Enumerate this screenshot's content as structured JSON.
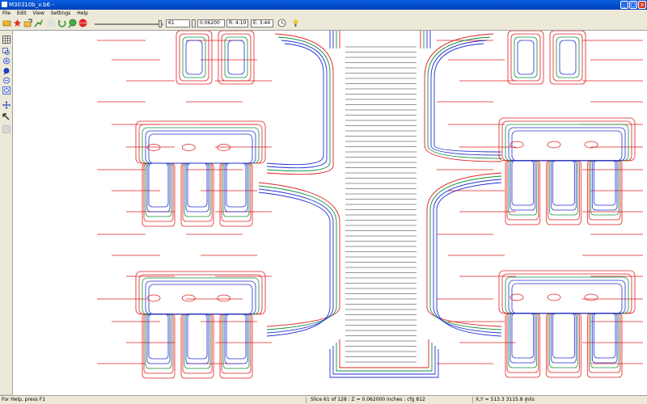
{
  "window": {
    "title": "M30310b_v.b6 -"
  },
  "menu": [
    "File",
    "Edit",
    "View",
    "Settings",
    "Help"
  ],
  "toolbar": {
    "layer_value": "61",
    "thickness_value": "0.06200",
    "readout_r": "R: 4:10",
    "readout_e": "E: 3:44"
  },
  "status": {
    "help": "For Help, press F1",
    "slice": "Slice   61 of   128 : Z = 0.062000 inches : cfg 812",
    "coords": "X,Y =   513.3   3115.8 mils"
  },
  "colors": {
    "red": "#e02020",
    "blue": "#2030d0",
    "green": "#109040",
    "grey": "#707070"
  },
  "icons": {
    "toolbar": [
      "open-folder-icon",
      "wizard-icon",
      "open-icon",
      "plot-icon",
      "blank-icon",
      "rotate-icon",
      "zoom-icon",
      "stop-icon"
    ],
    "left": [
      "grid-icon",
      "zoom-box-icon",
      "zoom-in-icon",
      "zoom-fit-icon",
      "zoom-out-icon",
      "zoom-window-icon",
      "pan-icon",
      "pointer-icon",
      "blank-tool-icon"
    ]
  }
}
